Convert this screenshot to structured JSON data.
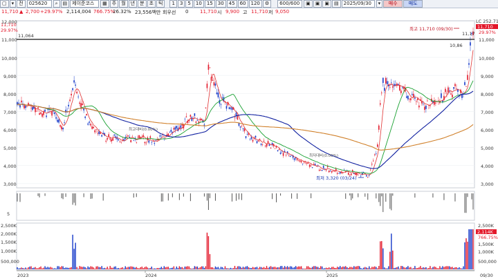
{
  "toolbar": {
    "market": "전",
    "code": "025620",
    "name": "제이준코스",
    "period_tabs": [
      "주",
      "월",
      "년",
      "분",
      "초",
      "틱"
    ],
    "interval_tabs": [
      "1",
      "3",
      "5",
      "10",
      "15",
      "30",
      "45",
      "60",
      "120"
    ],
    "count": "600/600",
    "date": "2025/09/30",
    "buy_label": "매수",
    "sell_label": "매도"
  },
  "quote": {
    "price": "11,710",
    "change": "2,700",
    "change_pct": "+29.97%",
    "volume": "2,114,004",
    "volume_ratio": "766.75%",
    "turnover": "26.32%",
    "amount": "23,556백만",
    "pref_label": "회우선",
    "pref_value": "0",
    "price2": "11,710",
    "open_label": "시",
    "open_value": "9,900",
    "high_label": "고",
    "high_value": "11,710",
    "low_label": "저",
    "low_value": "9,050"
  },
  "price_panel": {
    "info_left_price": "11,710",
    "info_left_pct": "29.97%",
    "hline_label": "11,064",
    "right_top": "LC 252.71",
    "right_price_tag": "11,710",
    "right_pct": "29.97%",
    "y_labels": [
      "12,000",
      "11,000",
      "10,000",
      "9,000",
      "8,000",
      "7,000",
      "6,000",
      "5,000",
      "4,000",
      "3,000"
    ],
    "y_labels_right": [
      "11,000",
      "10,000",
      "9,000",
      "8,000",
      "7,000",
      "6,000",
      "5,000",
      "4,000",
      "3,000"
    ],
    "high_annotation": "최고 11,710 (09/30)",
    "low_annotation": "최저 3,320 (03/24)",
    "label_1117": "11,17",
    "label_1086": "10,86",
    "mid_label_1": "최고대비(0.00%)",
    "mid_label_2": "최저대비(0.00%)"
  },
  "vol_panel": {
    "y_labels": [
      "2,500K",
      "2,000K",
      "1,500K",
      "1,000K",
      "500,000"
    ],
    "y_labels_right": [
      "2,500K",
      "1,500K",
      "1,000K",
      "500,000"
    ],
    "right_tag": "2,114K",
    "right_pct": "766.75%"
  },
  "mid_panel": {
    "y_label": "5"
  },
  "x_axis": [
    "2023",
    "2024",
    "2025",
    "09/30"
  ],
  "colors": {
    "up": "#e3182a",
    "down": "#1438c8",
    "ma5": "#e03030",
    "ma20": "#18a030",
    "ma60": "#1020a0",
    "ma120": "#d0802a"
  }
}
